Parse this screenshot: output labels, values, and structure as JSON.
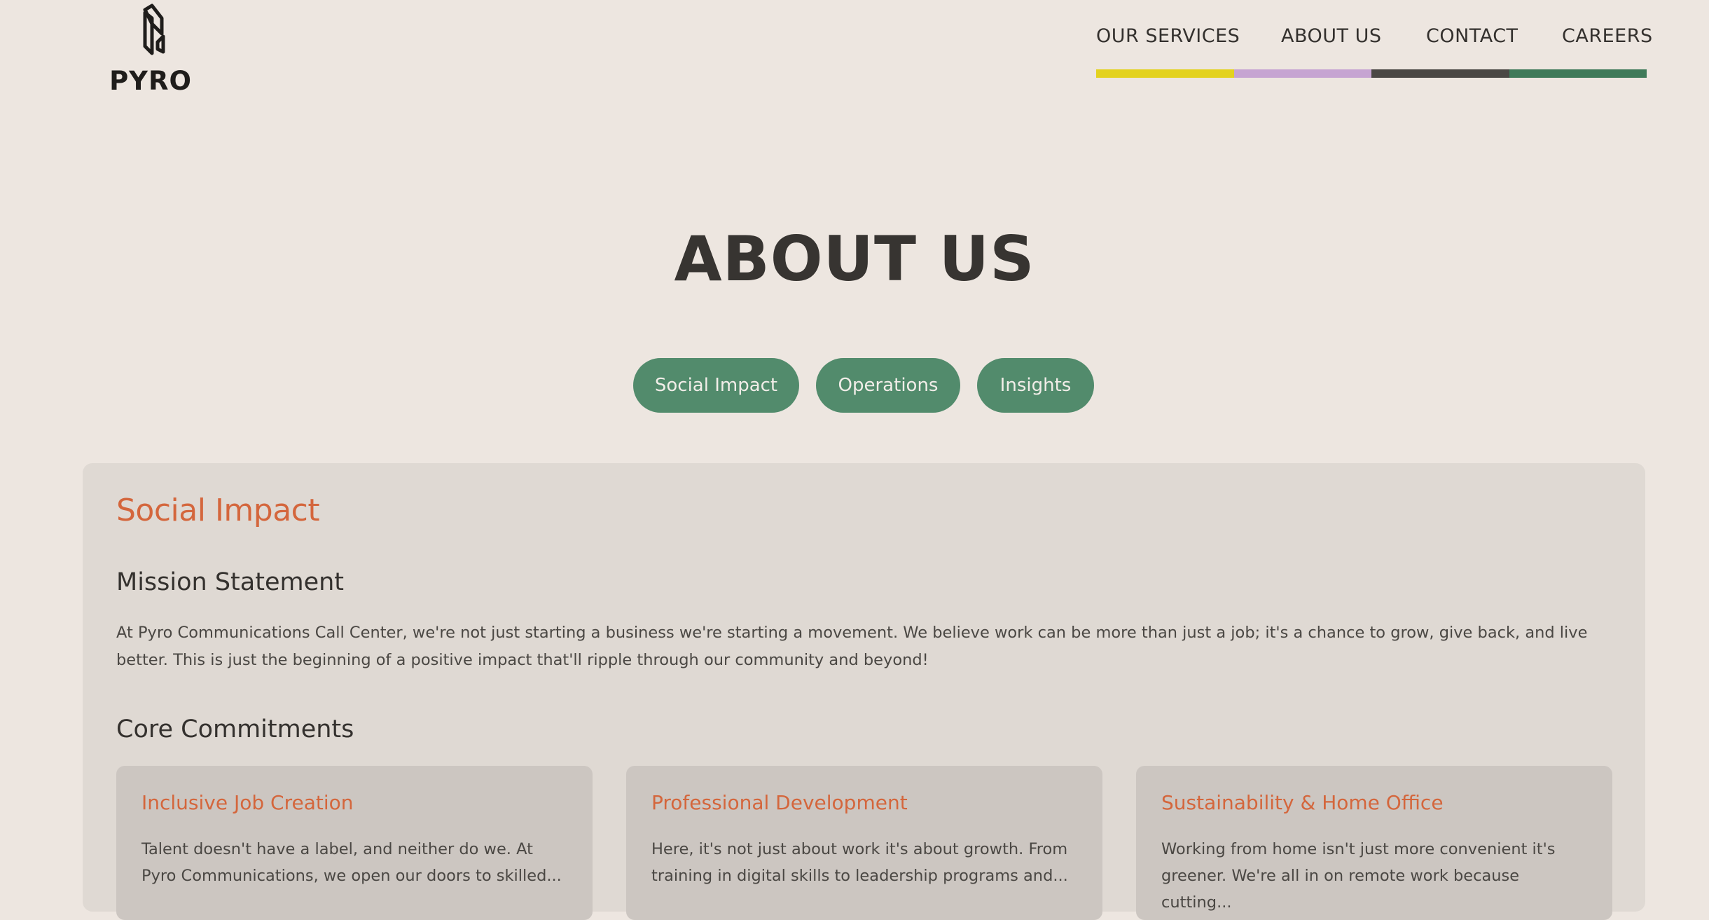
{
  "brand": {
    "name": "PYRO",
    "logo_icon": "pyro-logo-mark"
  },
  "nav": {
    "items": [
      {
        "label": "OUR SERVICES",
        "color": "#e3d21f"
      },
      {
        "label": "ABOUT US",
        "color": "#c6a4d2"
      },
      {
        "label": "CONTACT",
        "color": "#4a4744"
      },
      {
        "label": "CAREERS",
        "color": "#3f7a59"
      }
    ]
  },
  "page": {
    "title": "ABOUT US"
  },
  "tabs": [
    {
      "label": "Social Impact"
    },
    {
      "label": "Operations"
    },
    {
      "label": "Insights"
    }
  ],
  "section": {
    "title": "Social Impact",
    "mission": {
      "heading": "Mission Statement",
      "text": "At Pyro Communications Call Center, we're not just starting a business we're starting a movement. We believe work can be more than just a job; it's a chance to grow, give back, and live better. This is just the beginning of a positive impact that'll ripple through our community and beyond!"
    },
    "commitments": {
      "heading": "Core Commitments",
      "cards": [
        {
          "title": "Inclusive Job Creation",
          "text": "Talent doesn't have a label, and neither do we. At Pyro Communications, we open our doors to skilled..."
        },
        {
          "title": "Professional Development",
          "text": "Here, it's not just about work it's about growth. From training in digital skills to leadership programs and..."
        },
        {
          "title": "Sustainability & Home Office",
          "text": "Working from home isn't just more convenient it's greener. We're all in on remote work because cutting..."
        }
      ]
    }
  },
  "colors": {
    "background": "#ede6e0",
    "panel": "#dfd9d3",
    "card": "#ccc6c1",
    "accent": "#d4663c",
    "pill": "#528b6c"
  }
}
